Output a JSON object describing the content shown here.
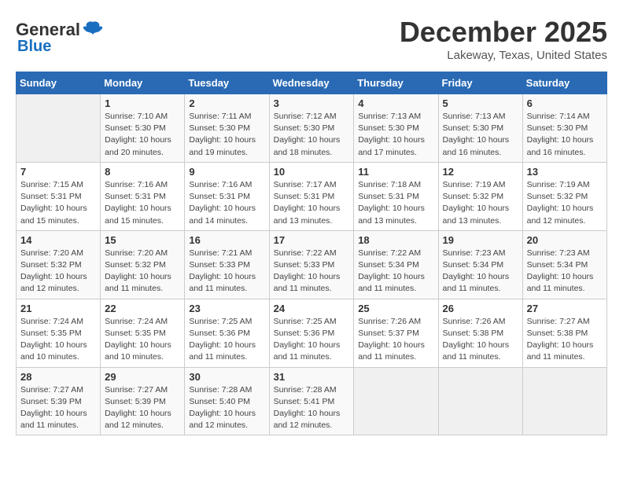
{
  "logo": {
    "general": "General",
    "blue": "Blue"
  },
  "header": {
    "month_year": "December 2025",
    "location": "Lakeway, Texas, United States"
  },
  "weekdays": [
    "Sunday",
    "Monday",
    "Tuesday",
    "Wednesday",
    "Thursday",
    "Friday",
    "Saturday"
  ],
  "weeks": [
    [
      {
        "day": "",
        "info": ""
      },
      {
        "day": "1",
        "info": "Sunrise: 7:10 AM\nSunset: 5:30 PM\nDaylight: 10 hours\nand 20 minutes."
      },
      {
        "day": "2",
        "info": "Sunrise: 7:11 AM\nSunset: 5:30 PM\nDaylight: 10 hours\nand 19 minutes."
      },
      {
        "day": "3",
        "info": "Sunrise: 7:12 AM\nSunset: 5:30 PM\nDaylight: 10 hours\nand 18 minutes."
      },
      {
        "day": "4",
        "info": "Sunrise: 7:13 AM\nSunset: 5:30 PM\nDaylight: 10 hours\nand 17 minutes."
      },
      {
        "day": "5",
        "info": "Sunrise: 7:13 AM\nSunset: 5:30 PM\nDaylight: 10 hours\nand 16 minutes."
      },
      {
        "day": "6",
        "info": "Sunrise: 7:14 AM\nSunset: 5:30 PM\nDaylight: 10 hours\nand 16 minutes."
      }
    ],
    [
      {
        "day": "7",
        "info": "Sunrise: 7:15 AM\nSunset: 5:31 PM\nDaylight: 10 hours\nand 15 minutes."
      },
      {
        "day": "8",
        "info": "Sunrise: 7:16 AM\nSunset: 5:31 PM\nDaylight: 10 hours\nand 15 minutes."
      },
      {
        "day": "9",
        "info": "Sunrise: 7:16 AM\nSunset: 5:31 PM\nDaylight: 10 hours\nand 14 minutes."
      },
      {
        "day": "10",
        "info": "Sunrise: 7:17 AM\nSunset: 5:31 PM\nDaylight: 10 hours\nand 13 minutes."
      },
      {
        "day": "11",
        "info": "Sunrise: 7:18 AM\nSunset: 5:31 PM\nDaylight: 10 hours\nand 13 minutes."
      },
      {
        "day": "12",
        "info": "Sunrise: 7:19 AM\nSunset: 5:32 PM\nDaylight: 10 hours\nand 13 minutes."
      },
      {
        "day": "13",
        "info": "Sunrise: 7:19 AM\nSunset: 5:32 PM\nDaylight: 10 hours\nand 12 minutes."
      }
    ],
    [
      {
        "day": "14",
        "info": "Sunrise: 7:20 AM\nSunset: 5:32 PM\nDaylight: 10 hours\nand 12 minutes."
      },
      {
        "day": "15",
        "info": "Sunrise: 7:20 AM\nSunset: 5:32 PM\nDaylight: 10 hours\nand 11 minutes."
      },
      {
        "day": "16",
        "info": "Sunrise: 7:21 AM\nSunset: 5:33 PM\nDaylight: 10 hours\nand 11 minutes."
      },
      {
        "day": "17",
        "info": "Sunrise: 7:22 AM\nSunset: 5:33 PM\nDaylight: 10 hours\nand 11 minutes."
      },
      {
        "day": "18",
        "info": "Sunrise: 7:22 AM\nSunset: 5:34 PM\nDaylight: 10 hours\nand 11 minutes."
      },
      {
        "day": "19",
        "info": "Sunrise: 7:23 AM\nSunset: 5:34 PM\nDaylight: 10 hours\nand 11 minutes."
      },
      {
        "day": "20",
        "info": "Sunrise: 7:23 AM\nSunset: 5:34 PM\nDaylight: 10 hours\nand 11 minutes."
      }
    ],
    [
      {
        "day": "21",
        "info": "Sunrise: 7:24 AM\nSunset: 5:35 PM\nDaylight: 10 hours\nand 10 minutes."
      },
      {
        "day": "22",
        "info": "Sunrise: 7:24 AM\nSunset: 5:35 PM\nDaylight: 10 hours\nand 10 minutes."
      },
      {
        "day": "23",
        "info": "Sunrise: 7:25 AM\nSunset: 5:36 PM\nDaylight: 10 hours\nand 11 minutes."
      },
      {
        "day": "24",
        "info": "Sunrise: 7:25 AM\nSunset: 5:36 PM\nDaylight: 10 hours\nand 11 minutes."
      },
      {
        "day": "25",
        "info": "Sunrise: 7:26 AM\nSunset: 5:37 PM\nDaylight: 10 hours\nand 11 minutes."
      },
      {
        "day": "26",
        "info": "Sunrise: 7:26 AM\nSunset: 5:38 PM\nDaylight: 10 hours\nand 11 minutes."
      },
      {
        "day": "27",
        "info": "Sunrise: 7:27 AM\nSunset: 5:38 PM\nDaylight: 10 hours\nand 11 minutes."
      }
    ],
    [
      {
        "day": "28",
        "info": "Sunrise: 7:27 AM\nSunset: 5:39 PM\nDaylight: 10 hours\nand 11 minutes."
      },
      {
        "day": "29",
        "info": "Sunrise: 7:27 AM\nSunset: 5:39 PM\nDaylight: 10 hours\nand 12 minutes."
      },
      {
        "day": "30",
        "info": "Sunrise: 7:28 AM\nSunset: 5:40 PM\nDaylight: 10 hours\nand 12 minutes."
      },
      {
        "day": "31",
        "info": "Sunrise: 7:28 AM\nSunset: 5:41 PM\nDaylight: 10 hours\nand 12 minutes."
      },
      {
        "day": "",
        "info": ""
      },
      {
        "day": "",
        "info": ""
      },
      {
        "day": "",
        "info": ""
      }
    ]
  ]
}
